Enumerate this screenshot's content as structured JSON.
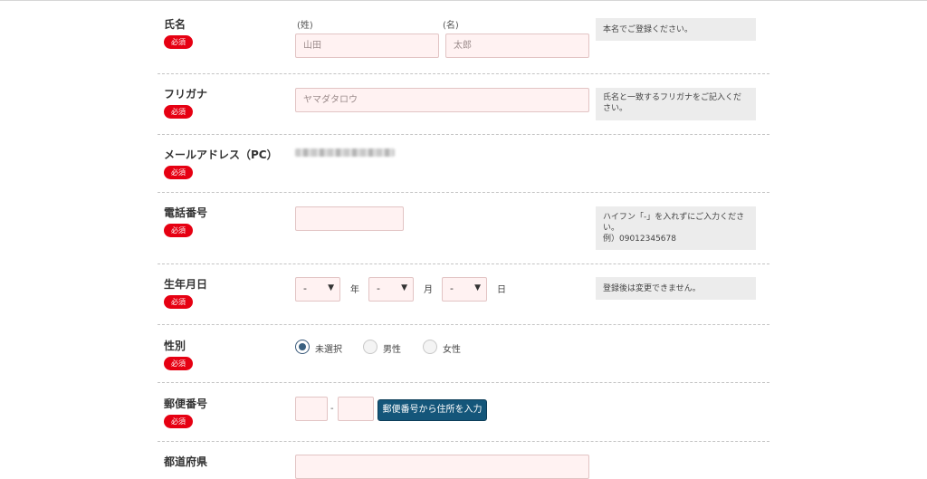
{
  "required_label": "必須",
  "name": {
    "label": "氏名",
    "last_sub": "(姓)",
    "first_sub": "(名)",
    "last_placeholder": "山田",
    "first_placeholder": "太郎",
    "note": "本名でご登録ください。"
  },
  "furigana": {
    "label": "フリガナ",
    "placeholder": "ヤマダタロウ",
    "note": "氏名と一致するフリガナをご記入ください。"
  },
  "email": {
    "label": "メールアドレス（PC）",
    "value_redacted": true
  },
  "phone": {
    "label": "電話番号",
    "value": "",
    "note_line1": "ハイフン「-」を入れずにご入力ください。",
    "note_line2": "例）09012345678"
  },
  "birthday": {
    "label": "生年月日",
    "year_value": "-",
    "month_value": "-",
    "day_value": "-",
    "year_unit": "年",
    "month_unit": "月",
    "day_unit": "日",
    "note": "登録後は変更できません。"
  },
  "gender": {
    "label": "性別",
    "options": [
      {
        "label": "未選択",
        "selected": true
      },
      {
        "label": "男性",
        "selected": false
      },
      {
        "label": "女性",
        "selected": false
      }
    ]
  },
  "postal": {
    "label": "郵便番号",
    "separator": "-",
    "button_label": "郵便番号から住所を入力"
  },
  "prefecture": {
    "label": "都道府県"
  },
  "colors": {
    "required_badge": "#e60012",
    "input_background": "#fff2f2",
    "button_background": "#14567a",
    "note_background": "#ececec"
  }
}
